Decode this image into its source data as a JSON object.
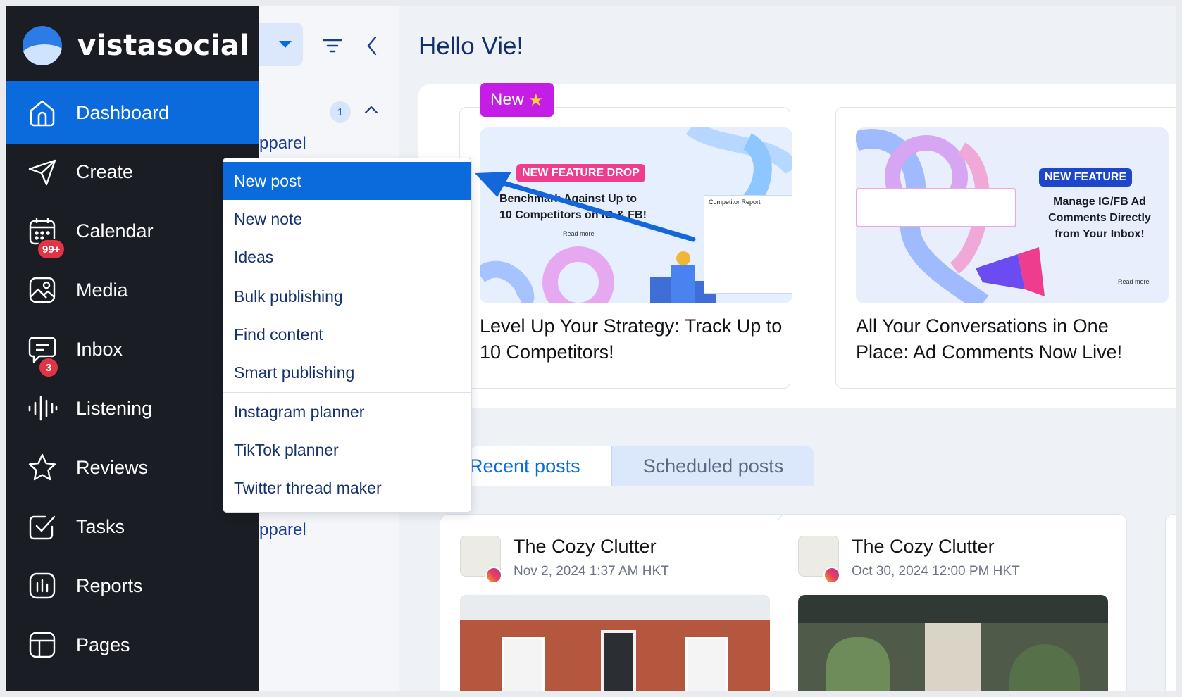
{
  "brand": {
    "name": "vistasocial",
    "accent": "#0b6bdc",
    "sidebar_bg": "#1a1d24"
  },
  "sidebar": {
    "items": [
      {
        "label": "Dashboard",
        "icon": "home-icon",
        "active": true
      },
      {
        "label": "Create",
        "icon": "paper-plane-icon"
      },
      {
        "label": "Calendar",
        "icon": "calendar-icon",
        "badge": "99+"
      },
      {
        "label": "Media",
        "icon": "image-icon"
      },
      {
        "label": "Inbox",
        "icon": "chat-icon",
        "badge": "3"
      },
      {
        "label": "Listening",
        "icon": "sound-wave-icon"
      },
      {
        "label": "Reviews",
        "icon": "star-icon"
      },
      {
        "label": "Tasks",
        "icon": "checkbox-icon"
      },
      {
        "label": "Reports",
        "icon": "bar-chart-icon"
      },
      {
        "label": "Pages",
        "icon": "layout-icon"
      }
    ]
  },
  "panel": {
    "group_count": "1",
    "items": [
      "pparel",
      "pparel",
      "pparel"
    ]
  },
  "create_menu": {
    "items": [
      "New post",
      "New note",
      "Ideas",
      "Bulk publishing",
      "Find content",
      "Smart publishing",
      "Instagram planner",
      "TikTok planner",
      "Twitter thread maker"
    ],
    "active_index": 0
  },
  "main": {
    "greeting": "Hello Vie!",
    "new_badge": "New",
    "cards": [
      {
        "title": "Level Up Your Strategy: Track Up to 10 Competitors!",
        "img_pill": "NEW FEATURE DROP",
        "img_text_1": "Benchmark Against Up to",
        "img_text_2": "10 Competitors on IG & FB!",
        "img_read_more": "Read more",
        "img_panel_title": "Competitor Report"
      },
      {
        "title": "All Your Conversations in One Place: Ad Comments Now Live!",
        "img_pill": "NEW FEATURE",
        "img_text_1": "Manage IG/FB Ad",
        "img_text_2": "Comments Directly",
        "img_text_3": "from Your Inbox!",
        "img_read_more": "Read more"
      }
    ],
    "tabs": [
      "Recent posts",
      "Scheduled posts"
    ],
    "posts": [
      {
        "name": "The Cozy Clutter",
        "date": "Nov 2, 2024 1:37 AM HKT"
      },
      {
        "name": "The Cozy Clutter",
        "date": "Oct 30, 2024 12:00 PM HKT"
      }
    ]
  }
}
